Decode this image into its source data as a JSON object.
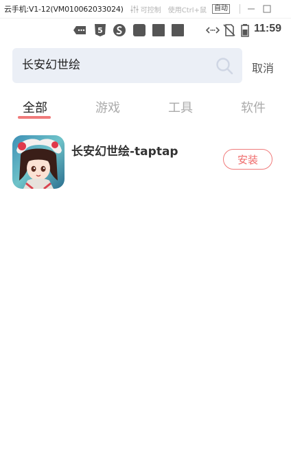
{
  "window": {
    "title": "云手机:V1-12(VM010062033024)",
    "control_label": "可控制",
    "ctrl_hint": "使用Ctrl+鼠",
    "auto_label": "自动"
  },
  "statusbar": {
    "time": "11:59",
    "icons": [
      "message-icon",
      "s5-icon",
      "sogou-icon",
      "app-icon",
      "app-icon",
      "app-icon",
      "code-icon",
      "no-sim-icon",
      "battery-icon"
    ]
  },
  "search": {
    "query": "长安幻世绘",
    "cancel_label": "取消"
  },
  "tabs": [
    {
      "label": "全部",
      "active": true
    },
    {
      "label": "游戏",
      "active": false
    },
    {
      "label": "工具",
      "active": false
    },
    {
      "label": "软件",
      "active": false
    }
  ],
  "results": [
    {
      "name": "长安幻世绘-taptap",
      "action_label": "安装"
    }
  ],
  "colors": {
    "accent": "#f07a7a",
    "search_bg": "#ebeff6"
  }
}
